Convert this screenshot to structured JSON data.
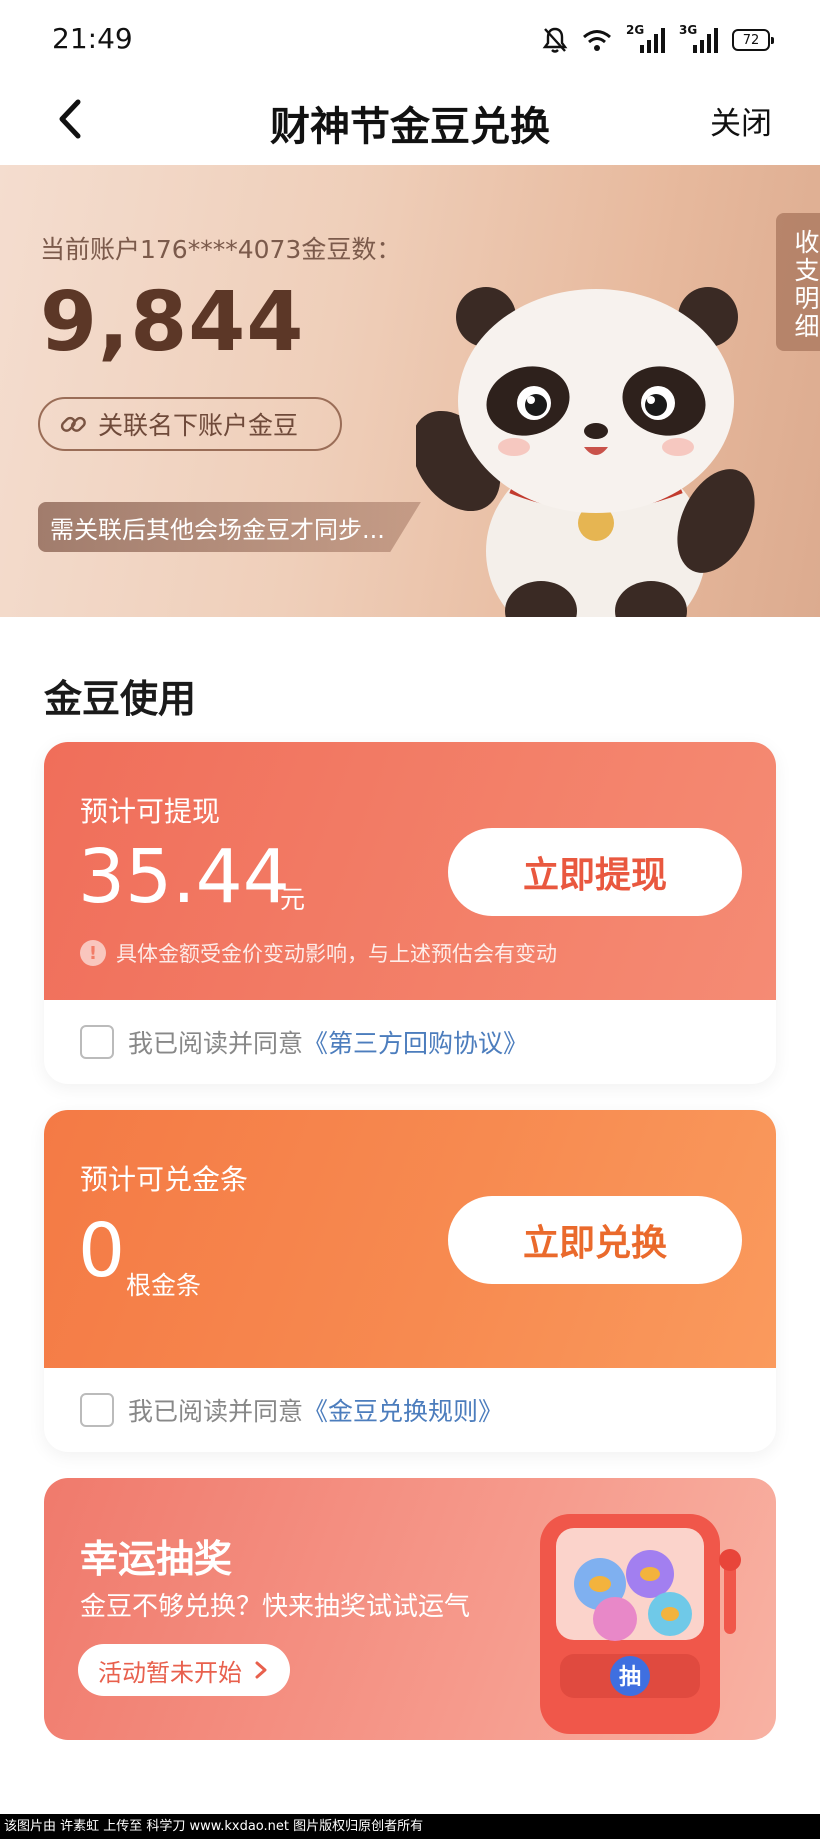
{
  "status_bar": {
    "time": "21:49",
    "net1": "2G",
    "net2": "3G",
    "battery": "72"
  },
  "nav": {
    "title": "财神节金豆兑换",
    "close_label": "关闭"
  },
  "hero": {
    "account_label": "当前账户176****4073金豆数：",
    "bean_count": "9,844",
    "link_button": "关联名下账户金豆",
    "note": "需关联后其他会场金豆才同步...",
    "detail_tab": "收支明细"
  },
  "section": {
    "title": "金豆使用"
  },
  "cards": [
    {
      "label": "预计可提现",
      "amount": "35.44",
      "unit": "元",
      "button": "立即提现",
      "warning": "具体金额受金价变动影响，与上述预估会有变动",
      "agree_text": "我已阅读并同意",
      "agree_link": "《第三方回购协议》"
    },
    {
      "label": "预计可兑金条",
      "amount": "0",
      "unit": "根金条",
      "button": "立即兑换",
      "agree_text": "我已阅读并同意",
      "agree_link": "《金豆兑换规则》"
    }
  ],
  "lucky": {
    "title": "幸运抽奖",
    "subtitle": "金豆不够兑换？快来抽奖试试运气",
    "button": "活动暂未开始",
    "machine_center": "抽"
  },
  "footer": {
    "watermark": "该图片由 许素虹 上传至 科学刀 www.kxdao.net 图片版权归原创者所有"
  },
  "icons": {
    "back": "chevron-left-icon",
    "link": "link-icon",
    "warn": "exclamation-icon",
    "arrow": "chevron-right-icon"
  },
  "colors": {
    "card1": "#f06e5a",
    "card2": "#f47a45",
    "card3": "#f07a6c",
    "bean_text": "#5c3727",
    "link_text": "#4c7dbd"
  }
}
